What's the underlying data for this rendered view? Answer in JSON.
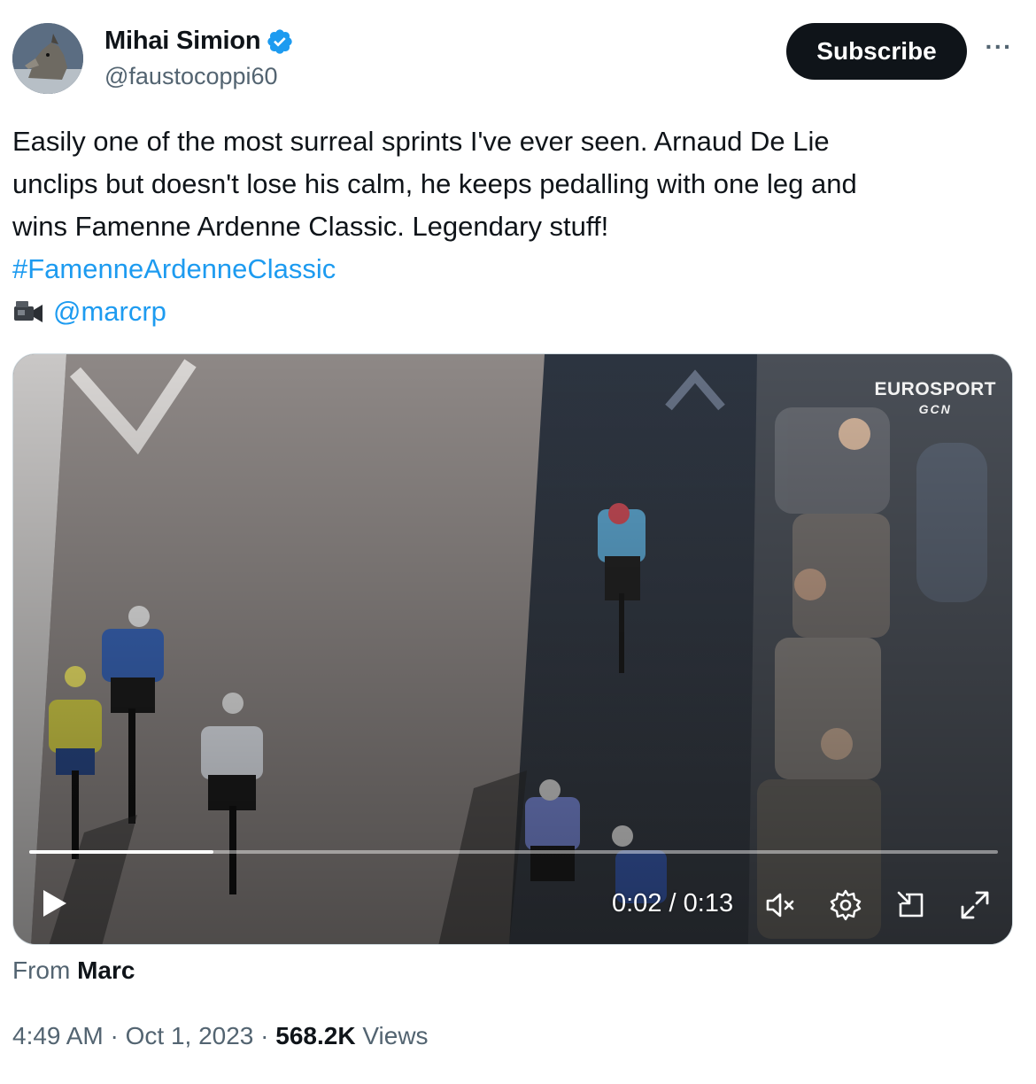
{
  "author": {
    "display_name": "Mihai Simion",
    "handle": "@faustocoppi60",
    "verified": true
  },
  "actions": {
    "subscribe_label": "Subscribe",
    "more_label": "···"
  },
  "tweet": {
    "lines": [
      "Easily one of the most surreal sprints I've ever seen. Arnaud De Lie",
      "unclips but doesn't lose his calm, he keeps pedalling with one leg and",
      "wins Famenne Ardenne Classic. Legendary stuff!"
    ],
    "hashtag": "#FamenneArdenneClassic",
    "camera_icon": "video-camera-icon",
    "credit_mention": "@marcrp"
  },
  "video": {
    "overlay_brand": "EUROSPORT",
    "overlay_sub_brand": "GCN",
    "current_time": "0:02",
    "duration": "0:13",
    "time_display": "0:02 / 0:13",
    "progress_fraction": 0.19,
    "controls": [
      "play-icon",
      "mute-icon",
      "settings-icon",
      "pip-icon",
      "fullscreen-icon"
    ]
  },
  "attribution": {
    "prefix": "From",
    "source": "Marc"
  },
  "meta": {
    "time": "4:49 AM",
    "separator": "·",
    "date": "Oct 1, 2023",
    "views_count": "568.2K",
    "views_label": "Views"
  },
  "colors": {
    "link": "#1d9bf0",
    "text_secondary": "#536471",
    "verified": "#1d9bf0"
  }
}
